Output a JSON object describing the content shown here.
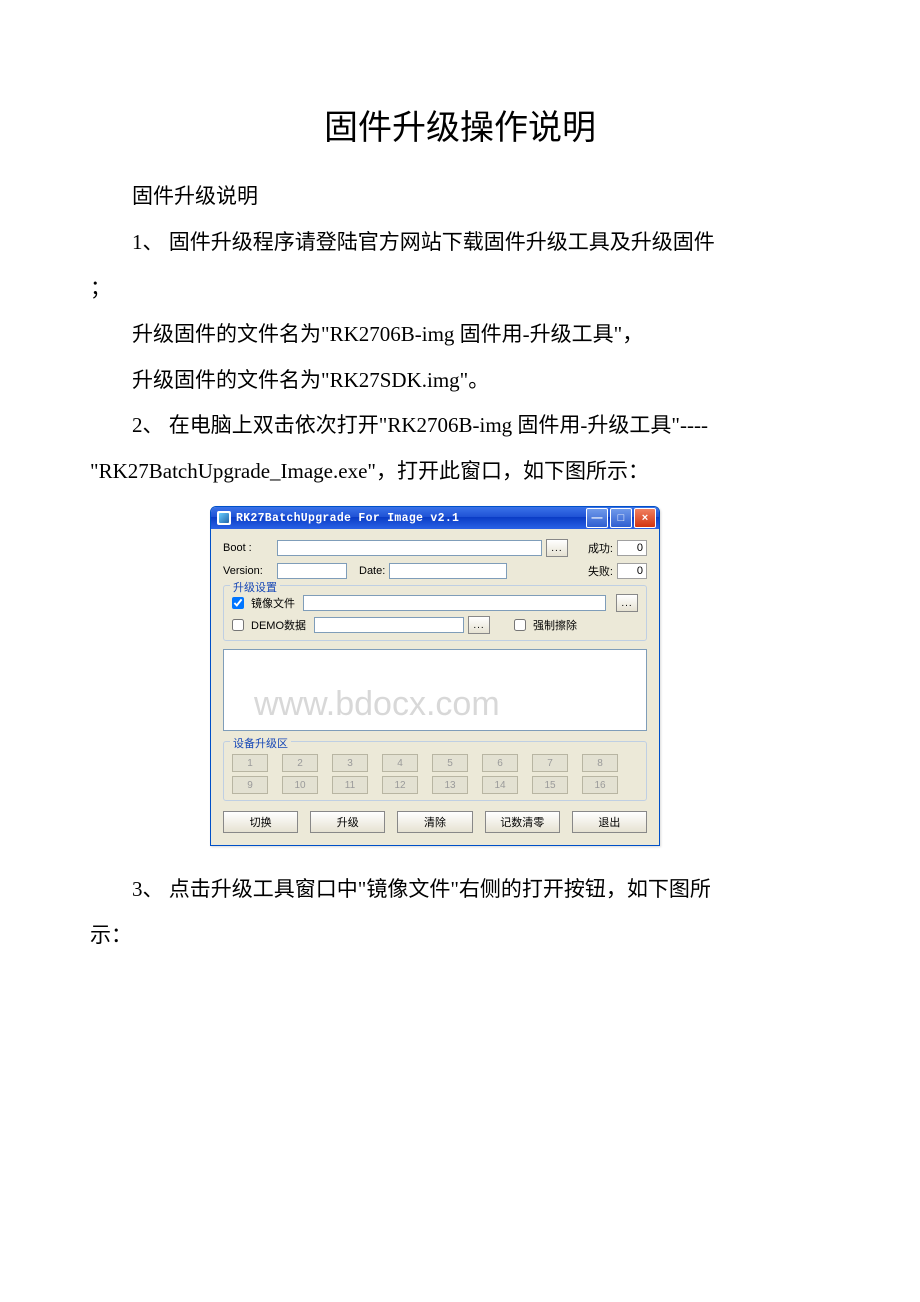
{
  "document": {
    "title": "固件升级操作说明",
    "para_heading": "固件升级说明",
    "para1a": "1、 固件升级程序请登陆官方网站下载固件升级工具及升级固件",
    "para1b": "；",
    "para2": "升级固件的文件名为\"RK2706B-img 固件用-升级工具\"，",
    "para3": "升级固件的文件名为\"RK27SDK.img\"。",
    "para4a": "2、 在电脑上双击依次打开\"RK2706B-img 固件用-升级工具\"----",
    "para4b": "\"RK27BatchUpgrade_Image.exe\"，打开此窗口，如下图所示：",
    "para5a": "3、 点击升级工具窗口中\"镜像文件\"右侧的打开按钮，如下图所",
    "para5b": "示："
  },
  "app": {
    "title": "RK27BatchUpgrade For Image v2.1",
    "labels": {
      "boot": "Boot :",
      "version": "Version:",
      "date": "Date:",
      "success": "成功:",
      "fail": "失败:",
      "group_upgrade": "升级设置",
      "chk_image": "镜像文件",
      "chk_demo": "DEMO数据",
      "chk_force": "强制擦除",
      "group_devices": "设备升级区",
      "browse": "..."
    },
    "counters": {
      "success": "0",
      "fail": "0"
    },
    "slots": [
      "1",
      "2",
      "3",
      "4",
      "5",
      "6",
      "7",
      "8",
      "9",
      "10",
      "11",
      "12",
      "13",
      "14",
      "15",
      "16"
    ],
    "actions": {
      "switch": "切换",
      "upgrade": "升级",
      "clear": "清除",
      "reset": "记数清零",
      "exit": "退出"
    },
    "titlebar": {
      "minimize": "—",
      "maximize": "□",
      "close": "×"
    }
  },
  "watermark": "www.bdocx.com"
}
